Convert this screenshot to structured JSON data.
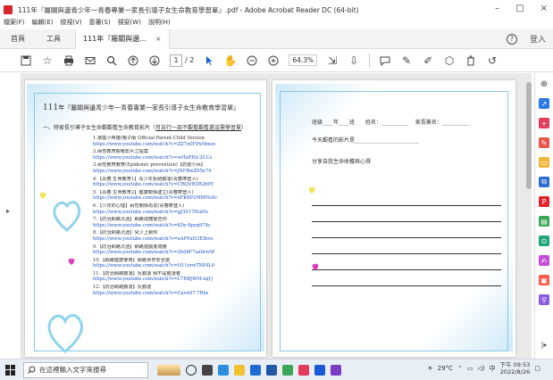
{
  "window": {
    "title": "111年『屬關與邊青少年一青春專業一家長引導子女生命教育學習單』.pdf - Adobe Acrobat Reader DC (64-bit)",
    "minimize": "–",
    "maximize": "□",
    "close": "×"
  },
  "menu": [
    "檔案(F)",
    "編輯(E)",
    "檢視(V)",
    "簽署(S)",
    "視窗(W)",
    "說明(H)"
  ],
  "tabs": {
    "home": "首頁",
    "tools": "工具",
    "document": "111年『屬關與邊...",
    "close": "×",
    "help": "?",
    "signin": "登入"
  },
  "toolbar": {
    "page_current": "1",
    "page_total": "/ 2",
    "zoom": "64.3%"
  },
  "document": {
    "left_page": {
      "title_prefix": "111",
      "title": "年『屬關與邊青少年一青春專業一家長引導子女生命教育學習單』",
      "subtitle_prefix": "一、特家長引導子女生命觀觀看生命教育影片（",
      "subtitle_link": "可自行一部不觀看觀看還這需學習單",
      "subtitle_suffix": "）",
      "items": [
        {
          "label": "1.家庭小英雄(親子版 Official Parent-Child Version",
          "url": "https://www.youtube.com/watch?v=ZZ7n0FPxMmoc"
        },
        {
          "label": "2.兩性教育觀看影片之提案",
          "url": "https://www.youtube.com/watch?v=wHuPHz-2CCs"
        },
        {
          "label": "3.兩性教育教育(Epidemic prevention)【防疫小兵】",
          "url": "https://www.youtube.com/watch?v=jNFBwZ95e74"
        },
        {
          "label": "4.【青春 生命教育1】青少年拒絕霸凌(青春摩登人)",
          "url": "https://www.youtube.com/watch?v=UBQVB3R2b9Y"
        },
        {
          "label": "5.【青春 生命教育2】健康關係建立(青春摩登人)",
          "url": "https://www.youtube.com/watch?v=eFK6P2MMNs0c"
        },
        {
          "label": "6.【少年的心理】兩性關係再思(青春摩登人)",
          "url": "https://www.youtube.com/watch?v=gJ3917Hut0s"
        },
        {
          "label": "7.【防治網路沉迷】網路成癮警告你",
          "url": "https://www.youtube.com/watch?v=K0y-8pzq974c"
        },
        {
          "label": "8.【防治網路沉迷】兒少上網你",
          "url": "https://www.youtube.com/watch?v=nAPFaH3EIbvo"
        },
        {
          "label": "9.【防治網路沉迷】網路遊戲要適度",
          "url": "https://www.youtube.com/watch?v=2h06F7ax0rwW"
        },
        {
          "label": "10.【網路健康使用】網路世界安全遊",
          "url": "https://www.youtube.com/watch?v=H11srwTMML0"
        },
        {
          "label": "11.【防治網路霸凌】反霸凌 我不是霸凌者",
          "url": "https://www.youtube.com/watch?v=L7RBJWM-xqQ"
        },
        {
          "label": "12.【防治網路霸凌】反霸凌",
          "url": "https://www.youtube.com/watch?v=Cavn07-7Rhs"
        }
      ]
    },
    "right_page": {
      "class_label": "班級",
      "year_label": "年",
      "class_suffix": "班",
      "name_label": "姓名：",
      "parent_label": "家長簽名：",
      "film_label": "今天觀看的影片是",
      "reflection_label": "分享自我生命收穫與心得"
    }
  },
  "taskbar": {
    "search_placeholder": "在這裡輸入文字來搜尋",
    "weather": "29°C",
    "ime": "中",
    "time": "下午 09:53",
    "date": "2022/8/26"
  },
  "colors": {
    "accent": "#1a5fd0",
    "frame": "#8ac8e8",
    "heart_blue": "#8fd4ec",
    "heart_yellow": "#f2e15a",
    "heart_magenta": "#e03ab8",
    "link": "#1b53c7"
  }
}
